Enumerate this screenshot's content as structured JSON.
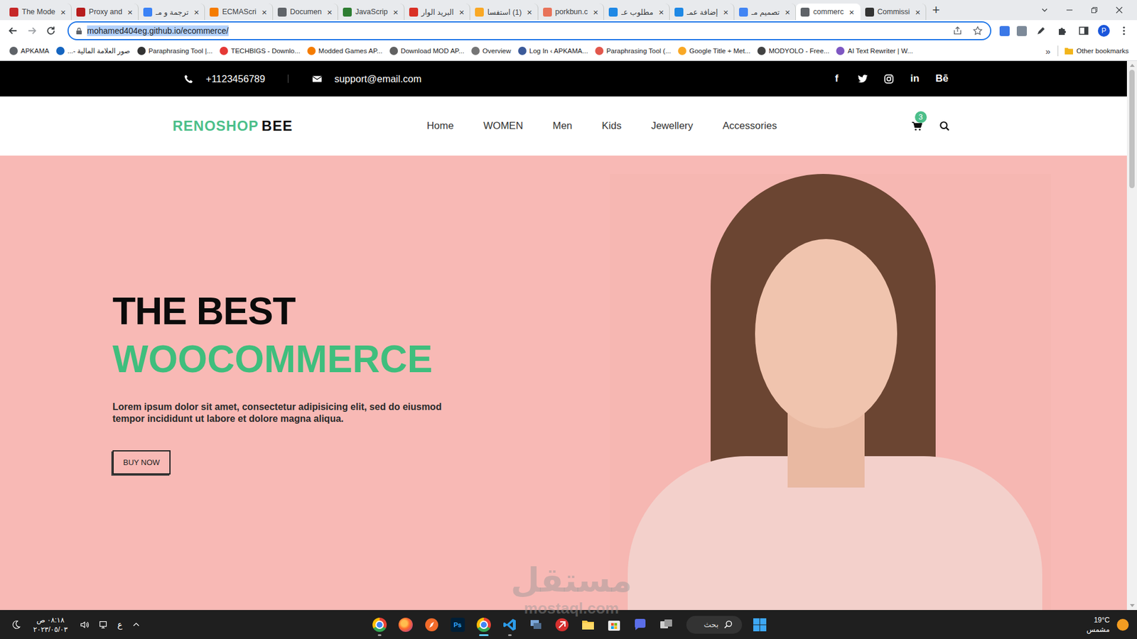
{
  "browser": {
    "tabs": [
      {
        "label": "The Mode",
        "selected": false,
        "color": "#c62828"
      },
      {
        "label": "Proxy and",
        "selected": false,
        "color": "#b71c1c"
      },
      {
        "label": "ترجمة و مـ",
        "selected": false,
        "color": "#3b82f6"
      },
      {
        "label": "ECMAScri",
        "selected": false,
        "color": "#f57c00"
      },
      {
        "label": "Documen",
        "selected": false,
        "color": "#5f6368"
      },
      {
        "label": "JavaScrip",
        "selected": false,
        "color": "#2e7d32"
      },
      {
        "label": "البريد الوار",
        "selected": false,
        "color": "#d93025"
      },
      {
        "label": "(1) استفسا",
        "selected": false,
        "color": "#f9a825"
      },
      {
        "label": "porkbun.c",
        "selected": false,
        "color": "#e8735a"
      },
      {
        "label": "مطلوب عـ",
        "selected": false,
        "color": "#1e88e5"
      },
      {
        "label": "إضافة عمـ",
        "selected": false,
        "color": "#1e88e5"
      },
      {
        "label": "تصميم مـ",
        "selected": false,
        "color": "#4285f4"
      },
      {
        "label": "commerc",
        "selected": true,
        "color": "#5f6368"
      },
      {
        "label": "Commissi",
        "selected": false,
        "color": "#333333"
      }
    ],
    "tab_close": "×",
    "new_tab": "+",
    "address": "mohamed404eg.github.io/ecommerce/",
    "profile": "P",
    "bookmarks": [
      {
        "label": "APKAMA",
        "color": "#5f6368"
      },
      {
        "label": "صور العلامة المالية -...",
        "color": "#1565c0"
      },
      {
        "label": "Paraphrasing Tool |...",
        "color": "#333333"
      },
      {
        "label": "TECHBIGS - Downlo...",
        "color": "#e53935"
      },
      {
        "label": "Modded Games AP...",
        "color": "#f57c00"
      },
      {
        "label": "Download MOD AP...",
        "color": "#616161"
      },
      {
        "label": "Overview",
        "color": "#757575"
      },
      {
        "label": "Log In ‹ APKAMA...",
        "color": "#3c5a99"
      },
      {
        "label": "Paraphrasing Tool (...",
        "color": "#e2574c"
      },
      {
        "label": "Google Title + Met...",
        "color": "#f9a825"
      },
      {
        "label": "MODYOLO - Free...",
        "color": "#424242"
      },
      {
        "label": "AI Text Rewriter | W...",
        "color": "#7e57c2"
      }
    ],
    "more_bookmarks": "»",
    "other_bookmarks": "Other bookmarks"
  },
  "page": {
    "topbar": {
      "phone": "+1123456789",
      "email": "support@email.com",
      "socials": [
        {
          "kind": "glyph",
          "label": "f"
        },
        {
          "kind": "twitter"
        },
        {
          "kind": "instagram"
        },
        {
          "kind": "glyph",
          "label": "in"
        },
        {
          "kind": "glyph",
          "label": "Bē"
        }
      ]
    },
    "logo": {
      "first": "RENOSHOP",
      "second": "BEE"
    },
    "nav": [
      {
        "label": "Home",
        "selected": false
      },
      {
        "label": "WOMEN",
        "selected": false
      },
      {
        "label": "Men",
        "selected": false
      },
      {
        "label": "Kids",
        "selected": false
      },
      {
        "label": "Jewellery",
        "selected": false
      },
      {
        "label": "Accessories",
        "selected": false
      }
    ],
    "cart_count": "3",
    "hero": {
      "title": "THE BEST",
      "highlight": "WOOCOMMERCE",
      "text": "Lorem ipsum dolor sit amet, consectetur adipisicing elit, sed do eiusmod tempor incididunt ut labore et dolore magna aliqua.",
      "button": "BUY NOW"
    }
  },
  "watermark": {
    "arabic": "مستقل",
    "latin": "mostaql.com"
  },
  "taskbar": {
    "time": "٠٨:١٨ ص",
    "date": "٢٠٢٣/٠٥/٠٣",
    "language": "ع",
    "search": "بحث",
    "weather": {
      "temp": "19°C",
      "condition": "مشمس"
    },
    "apps": [
      {
        "kind": "chrome",
        "running": true,
        "active": false
      },
      {
        "kind": "firefox",
        "running": false,
        "active": false
      },
      {
        "kind": "compass",
        "running": false,
        "active": false
      },
      {
        "kind": "photoshop",
        "label": "Ps",
        "running": false,
        "active": false
      },
      {
        "kind": "chrome",
        "running": true,
        "active": true
      },
      {
        "kind": "vscode",
        "running": true,
        "active": false
      },
      {
        "kind": "remote",
        "running": false,
        "active": false
      },
      {
        "kind": "red",
        "running": false,
        "active": false
      },
      {
        "kind": "folder",
        "running": false,
        "active": false
      },
      {
        "kind": "store",
        "running": false,
        "active": false
      },
      {
        "kind": "chat",
        "running": false,
        "active": false
      },
      {
        "kind": "taskview",
        "running": false,
        "active": false
      }
    ]
  }
}
